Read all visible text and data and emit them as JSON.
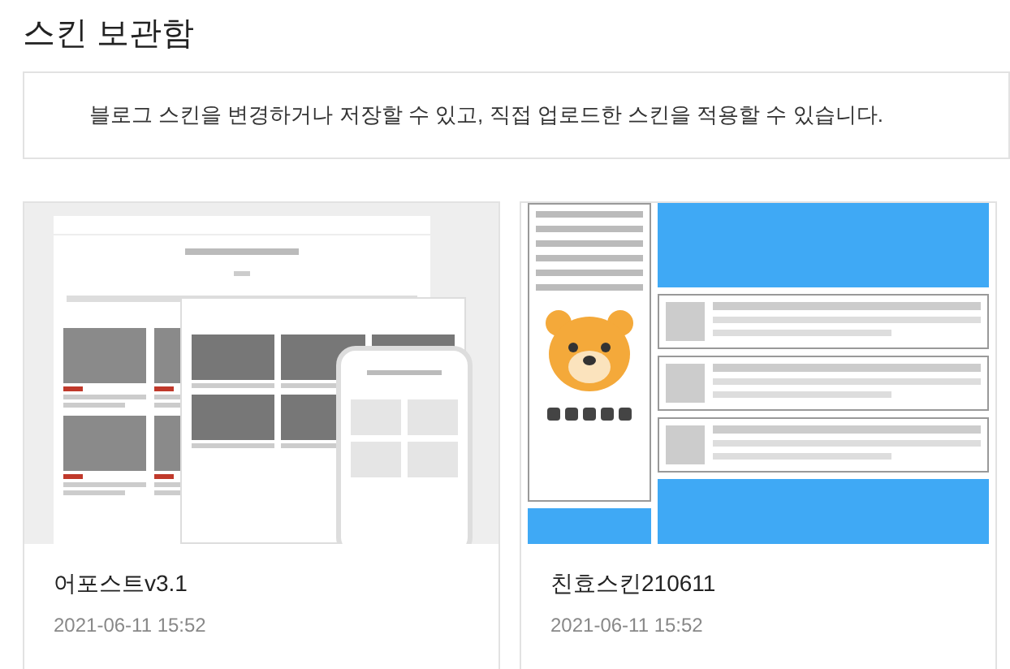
{
  "title": "스킨 보관함",
  "notice": "블로그 스킨을 변경하거나 저장할 수 있고, 직접 업로드한 스킨을 적용할 수 있습니다.",
  "skins": [
    {
      "kind": "photo",
      "name": "어포스트v3.1",
      "date": "2021-06-11 15:52"
    },
    {
      "kind": "illustration",
      "name": "친효스킨210611",
      "date": "2021-06-11 15:52"
    }
  ]
}
